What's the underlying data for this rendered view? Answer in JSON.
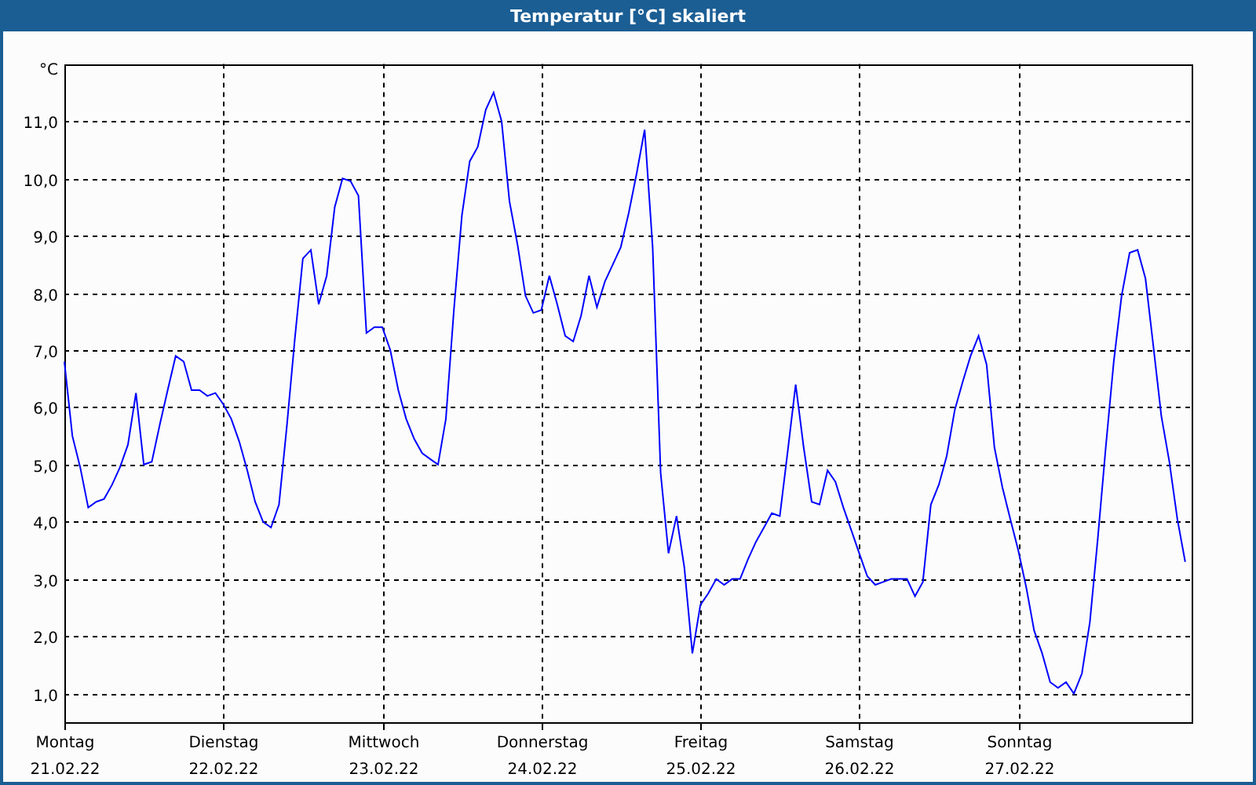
{
  "window": {
    "title": "Temperatur [°C] skaliert"
  },
  "chart": {
    "tick_dates": [
      "21.02.22",
      "22.02.22",
      "23.02.22",
      "24.02.22",
      "25.02.22",
      "26.02.22",
      "27.02.22"
    ],
    "chart_data": {
      "type": "line",
      "grid": true,
      "ylabel": "°C",
      "ylim": [
        0.5,
        12
      ],
      "yticks": [
        {
          "value": 1,
          "label": "1,0"
        },
        {
          "value": 2,
          "label": "2,0"
        },
        {
          "value": 3,
          "label": "3,0"
        },
        {
          "value": 4,
          "label": "4,0"
        },
        {
          "value": 5,
          "label": "5,0"
        },
        {
          "value": 6,
          "label": "6,0"
        },
        {
          "value": 7,
          "label": "7,0"
        },
        {
          "value": 8,
          "label": "8,0"
        },
        {
          "value": 9,
          "label": "9,0"
        },
        {
          "value": 10,
          "label": "10,0"
        },
        {
          "value": 11,
          "label": "11,0"
        }
      ],
      "categories": [
        "Montag",
        null,
        null,
        null,
        null,
        null,
        null,
        null,
        null,
        null,
        null,
        null,
        null,
        null,
        null,
        null,
        null,
        null,
        null,
        null,
        "Dienstag",
        null,
        null,
        null,
        null,
        null,
        null,
        null,
        null,
        null,
        null,
        null,
        null,
        null,
        null,
        null,
        null,
        null,
        null,
        null,
        "Mittwoch",
        null,
        null,
        null,
        null,
        null,
        null,
        null,
        null,
        null,
        null,
        null,
        null,
        null,
        null,
        null,
        null,
        null,
        null,
        null,
        "Donnerstag",
        null,
        null,
        null,
        null,
        null,
        null,
        null,
        null,
        null,
        null,
        null,
        null,
        null,
        null,
        null,
        null,
        null,
        null,
        null,
        "Freitag",
        null,
        null,
        null,
        null,
        null,
        null,
        null,
        null,
        null,
        null,
        null,
        null,
        null,
        null,
        null,
        null,
        null,
        null,
        null,
        "Samstag",
        null,
        null,
        null,
        null,
        null,
        null,
        null,
        null,
        null,
        null,
        null,
        null,
        null,
        null,
        null,
        null,
        null,
        null,
        null,
        "Sonntag",
        null,
        null,
        null,
        null,
        null,
        null,
        null,
        null,
        null,
        null,
        null,
        null,
        null,
        null,
        null,
        null,
        null,
        null,
        null,
        null,
        null
      ],
      "series": [
        {
          "color": "#0000ff",
          "values": [
            6.8,
            5.5,
            4.95,
            4.25,
            4.35,
            4.4,
            4.65,
            4.95,
            5.35,
            6.25,
            5.0,
            5.05,
            5.7,
            6.3,
            6.9,
            6.8,
            6.3,
            6.3,
            6.2,
            6.25,
            6.05,
            5.8,
            5.4,
            4.9,
            4.35,
            4.0,
            3.9,
            4.3,
            5.7,
            7.2,
            8.6,
            8.75,
            7.8,
            8.3,
            9.5,
            10.0,
            9.95,
            9.7,
            7.3,
            7.4,
            7.4,
            7.0,
            6.3,
            5.8,
            5.45,
            5.2,
            5.1,
            5.0,
            5.8,
            7.7,
            9.35,
            10.3,
            10.55,
            11.2,
            11.5,
            11.0,
            9.6,
            8.85,
            7.95,
            7.65,
            7.7,
            8.3,
            7.8,
            7.25,
            7.15,
            7.6,
            8.3,
            7.75,
            8.2,
            8.5,
            8.8,
            9.4,
            10.1,
            10.85,
            8.8,
            4.85,
            3.45,
            4.1,
            3.2,
            1.7,
            2.55,
            2.75,
            3.0,
            2.9,
            3.0,
            3.0,
            3.35,
            3.65,
            3.9,
            4.15,
            4.1,
            5.25,
            6.4,
            5.3,
            4.35,
            4.3,
            4.9,
            4.7,
            4.25,
            3.85,
            3.45,
            3.05,
            2.9,
            2.95,
            3.0,
            3.0,
            3.0,
            2.7,
            2.95,
            4.3,
            4.65,
            5.15,
            5.95,
            6.45,
            6.9,
            7.25,
            6.75,
            5.3,
            4.6,
            4.05,
            3.5,
            2.85,
            2.1,
            1.7,
            1.2,
            1.1,
            1.2,
            1.0,
            1.35,
            2.25,
            3.7,
            5.3,
            6.8,
            7.95,
            8.7,
            8.75,
            8.25,
            7.05,
            5.85,
            5.05,
            4.05,
            3.3
          ]
        }
      ]
    }
  }
}
